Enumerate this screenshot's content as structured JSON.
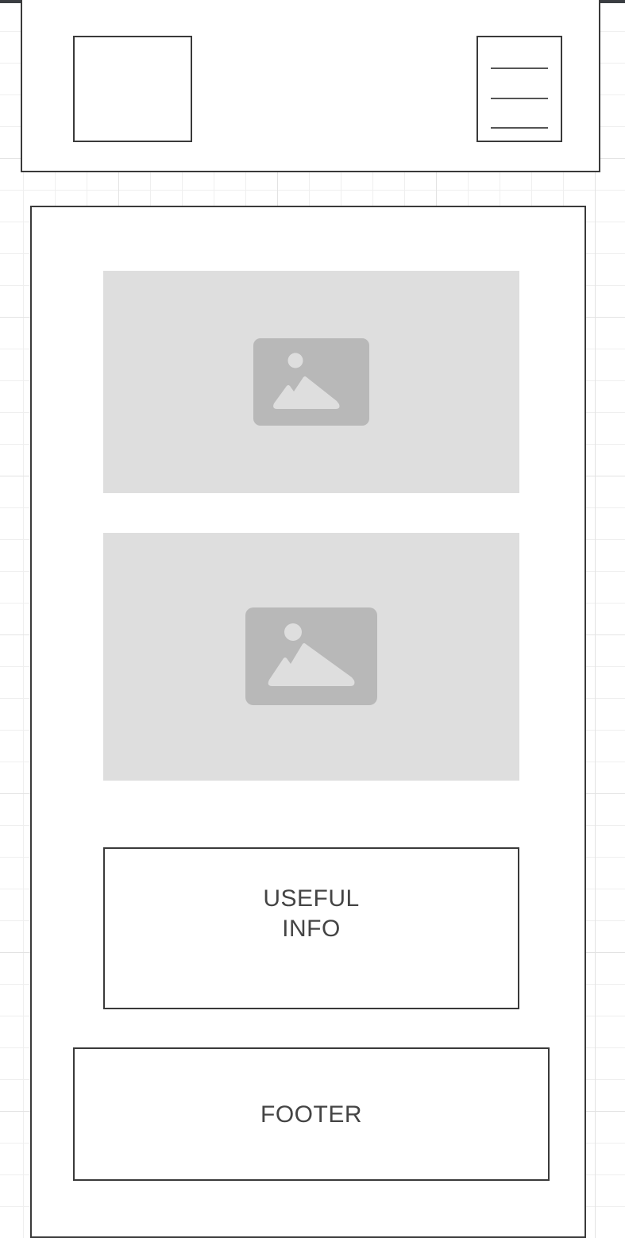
{
  "header": {
    "logo_icon": "blank-box",
    "menu_icon": "hamburger-menu-icon"
  },
  "main": {
    "images": [
      {
        "icon": "image-placeholder-icon"
      },
      {
        "icon": "image-placeholder-icon"
      }
    ],
    "info": {
      "line1": "USEFUL",
      "line2": "INFO"
    }
  },
  "footer": {
    "label": "FOOTER"
  },
  "colors": {
    "border": "#3a3a3a",
    "placeholder_bg": "#dedede",
    "placeholder_icon": "#b8b8b8",
    "text": "#444444",
    "top_bar": "#3a3d42",
    "grid": "#e3e3e3"
  }
}
